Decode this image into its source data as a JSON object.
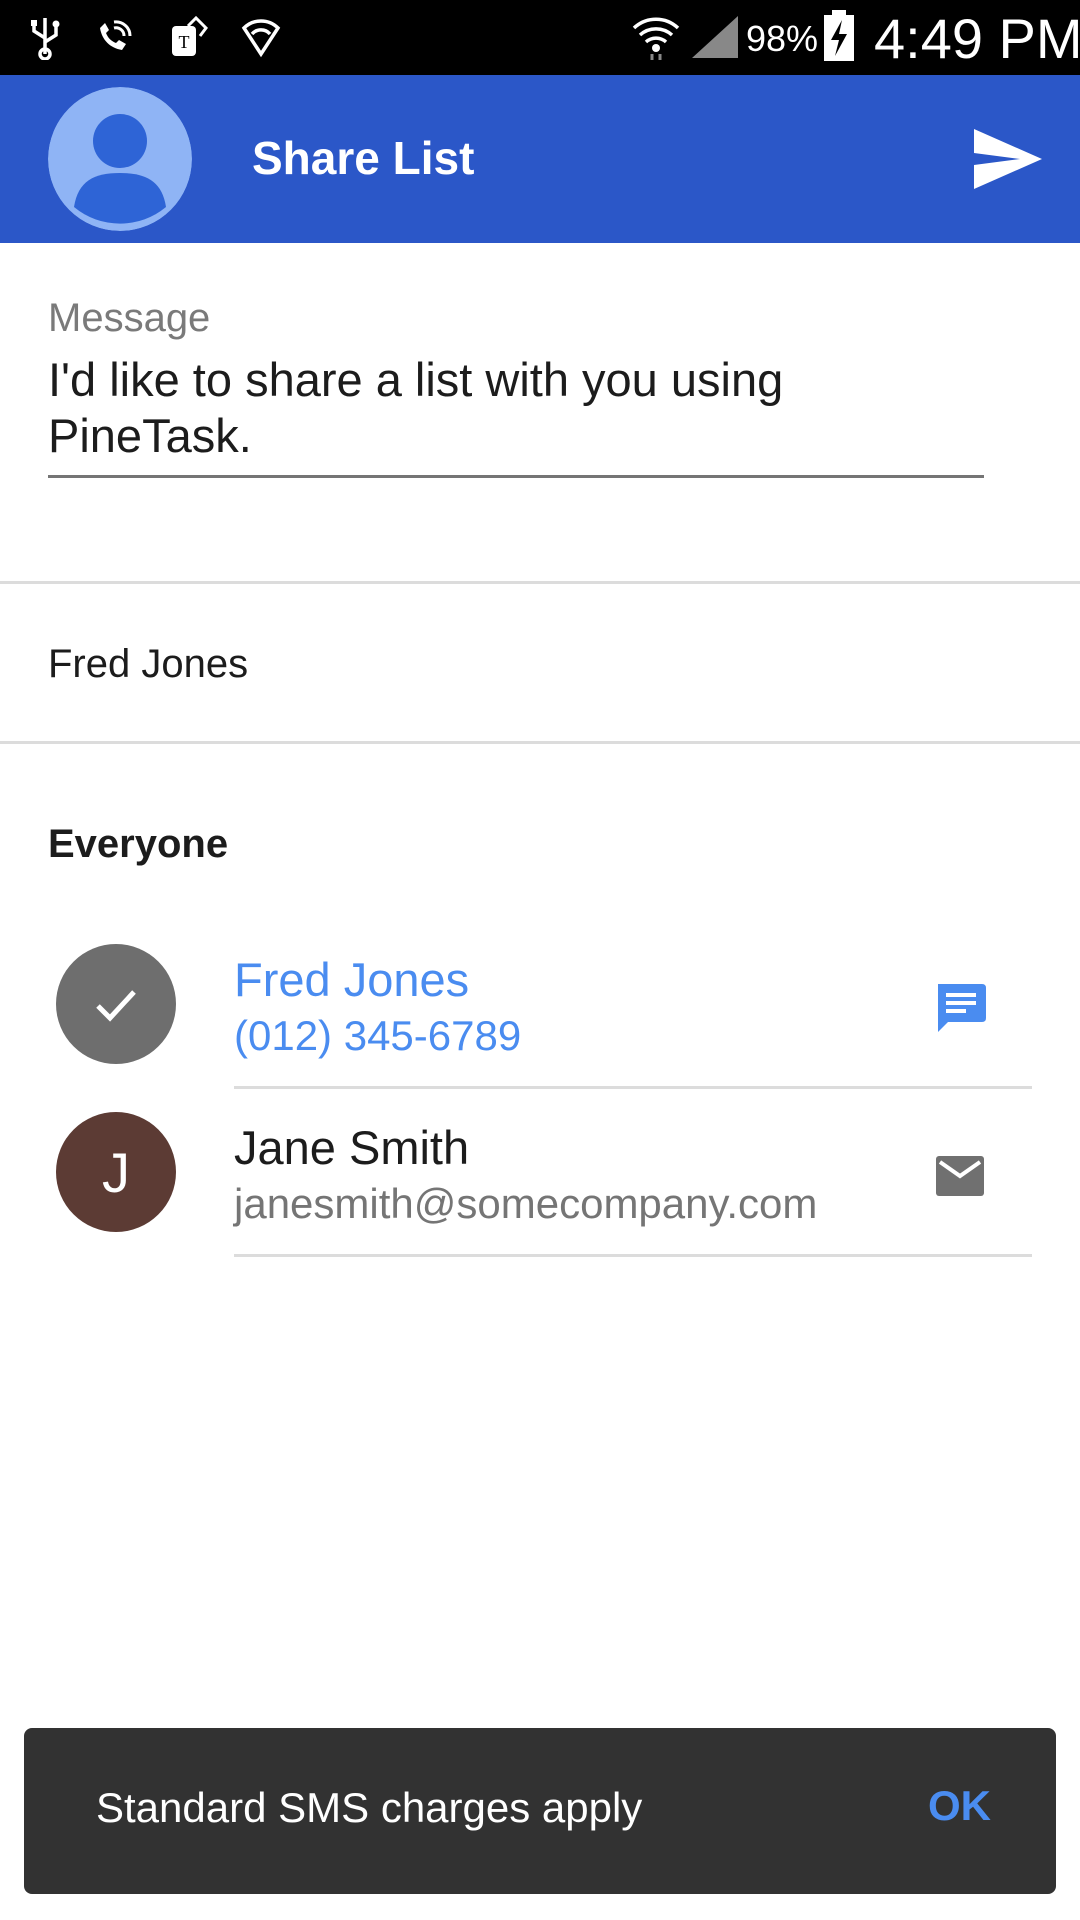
{
  "status_bar": {
    "battery_percent": "98%",
    "time": "4:49 PM",
    "icons": [
      "usb-icon",
      "wifi-call-icon",
      "tmobile-icon",
      "vpn-shield-icon",
      "wifi-icon",
      "cell-signal-icon",
      "battery-charging-icon"
    ]
  },
  "app_bar": {
    "title": "Share List",
    "background_color": "#2b57c8",
    "avatar_icon": "account-avatar-icon",
    "send_icon": "send-icon"
  },
  "message": {
    "label": "Message",
    "value": "I'd like to share a list with you using PineTask."
  },
  "recipient": {
    "name": "Fred Jones"
  },
  "contacts_section": {
    "heading": "Everyone",
    "items": [
      {
        "name": "Fred Jones",
        "detail": "(012) 345-6789",
        "selected": true,
        "avatar_color": "#6e6e6e",
        "avatar_icon": "checkmark-icon",
        "action_icon": "sms-message-icon",
        "text_color": "#4a8cf0"
      },
      {
        "name": "Jane Smith",
        "detail": "janesmith@somecompany.com",
        "selected": false,
        "avatar_initial": "J",
        "avatar_color": "#5c3b34",
        "action_icon": "email-icon",
        "text_color": "#1c1c1c"
      }
    ]
  },
  "snackbar": {
    "text": "Standard SMS charges apply",
    "action": "OK",
    "action_color": "#4a8cf0"
  }
}
